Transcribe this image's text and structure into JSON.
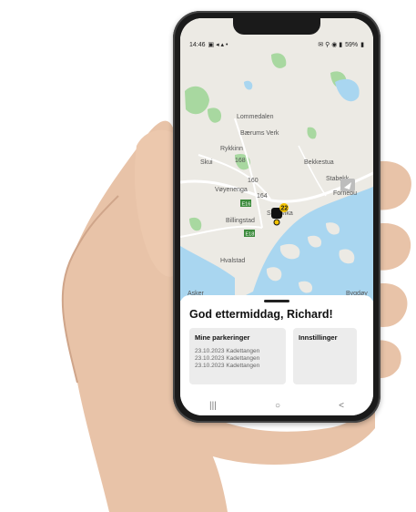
{
  "status": {
    "time": "14:46",
    "battery": "59%"
  },
  "map": {
    "labels": [
      "Lommedalen",
      "Bærums Verk",
      "Rykkinn",
      "Skui",
      "Vøyenenga",
      "Billingstad",
      "Sandvika",
      "Bekkestua",
      "Stabekk",
      "Fornebu",
      "Hvalstad",
      "Asker",
      "Bygdøy"
    ],
    "road_numbers": [
      "168",
      "160",
      "164"
    ],
    "road_shields": [
      "E16",
      "E18"
    ],
    "cluster_count": "22"
  },
  "sheet": {
    "greeting": "God ettermiddag, Richard!",
    "cards": {
      "parking": {
        "title": "Mine parkeringer",
        "rows": [
          "23.10.2023 Kadettangen",
          "23.10.2023 Kadettangen",
          "23.10.2023 Kadettangen"
        ]
      },
      "settings": {
        "title": "Innstillinger"
      }
    }
  },
  "nav": {
    "recents": "|||",
    "home": "○",
    "back": "<"
  },
  "colors": {
    "water": "#a9d6f0",
    "forest": "#a8d8a0",
    "land": "#eceae4",
    "road": "#ffffff",
    "card": "#ececec",
    "phone": "#1a1a1a"
  }
}
